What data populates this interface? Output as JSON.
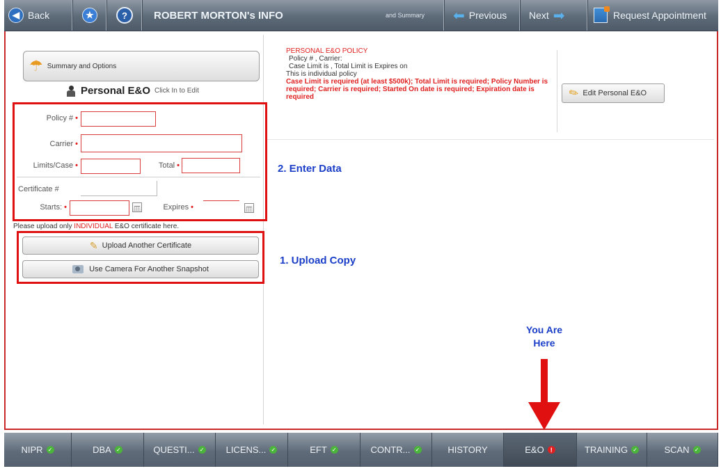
{
  "topbar": {
    "back_label": "Back",
    "title": "ROBERT MORTON's INFO",
    "summary_link": "and Summary",
    "previous_label": "Previous",
    "next_label": "Next",
    "request_label": "Request Appointment"
  },
  "left": {
    "summary_button": "Summary and Options",
    "section_title": "Personal E&O",
    "click_hint": "Click In to Edit",
    "form": {
      "policy_label": "Policy #",
      "carrier_label": "Carrier",
      "limits_label": "Limits/Case",
      "total_label": "Total",
      "certificate_label": "Certificate #",
      "starts_label": "Starts:",
      "expires_label": "Expires",
      "policy_value": "",
      "carrier_value": "",
      "limits_value": "",
      "total_value": "",
      "certificate_value": "",
      "starts_value": "",
      "expires_value": ""
    },
    "upload_notice_prefix": "Please upload only ",
    "upload_notice_highlight": "INDIVIDUAL",
    "upload_notice_suffix": " E&O certificate here.",
    "upload_button": "Upload Another Certificate",
    "camera_button": "Use Camera For Another Snapshot"
  },
  "right": {
    "policy_heading": "PERSONAL E&O POLICY",
    "policy_line1": "Policy # , Carrier:",
    "policy_line2": "Case Limit is , Total Limit is   Expires on",
    "policy_line3": "This is individual policy",
    "policy_errors": "Case Limit is required (at least $500k); Total Limit is required; Policy Number is required; Carrier is required; Started On date is required; Expiration date is required",
    "edit_button": "Edit Personal E&O"
  },
  "annotations": {
    "step2": "2.  Enter Data",
    "step1": "1.  Upload Copy",
    "you_are": "You Are",
    "here": "Here"
  },
  "tabs": [
    {
      "label": "NIPR",
      "status": "ok"
    },
    {
      "label": "DBA",
      "status": "ok"
    },
    {
      "label": "QUESTI...",
      "status": "ok"
    },
    {
      "label": "LICENS...",
      "status": "ok"
    },
    {
      "label": "EFT",
      "status": "ok"
    },
    {
      "label": "CONTR...",
      "status": "ok"
    },
    {
      "label": "HISTORY",
      "status": "none"
    },
    {
      "label": "E&O",
      "status": "error"
    },
    {
      "label": "TRAINING",
      "status": "ok"
    },
    {
      "label": "SCAN",
      "status": "ok"
    }
  ],
  "colors": {
    "accent_red": "#e01010",
    "note_blue": "#1a3ec8",
    "ok_green": "#4bb43a"
  }
}
